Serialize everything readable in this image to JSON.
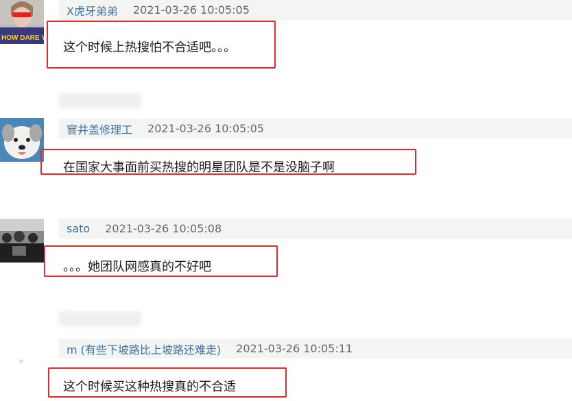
{
  "comments": [
    {
      "username": "X虎牙弟弟",
      "timestamp": "2021-03-26 10:05:05",
      "text": "这个时候上热搜怕不合适吧。。。",
      "avatar_text": "HOW DARE Y"
    },
    {
      "username": "窨井盖修理工",
      "timestamp": "2021-03-26 10:05:05",
      "text": "在国家大事面前买热搜的明星团队是不是没脑子啊"
    },
    {
      "username": "sato",
      "timestamp": "2021-03-26 10:05:08",
      "text": "。。。她团队网感真的不好吧"
    },
    {
      "username": "m (有些下坡路比上坡路还难走)",
      "timestamp": "2021-03-26 10:05:11",
      "text": "这个时候买这种热搜真的不合适"
    }
  ],
  "colors": {
    "username": "#3f6fa2",
    "highlight_border": "#e3282e",
    "header_bg": "#f2f5f2"
  }
}
